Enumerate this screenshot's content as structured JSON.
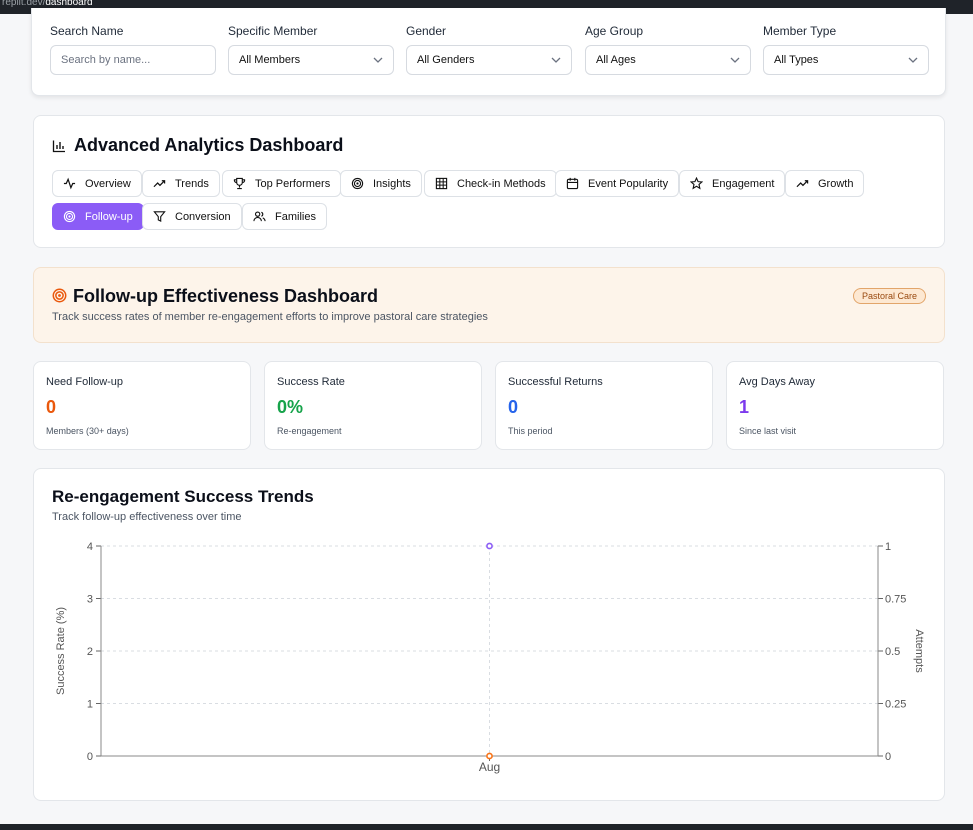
{
  "browser": {
    "url": "replit.dev/",
    "path": "dashboard"
  },
  "filters": {
    "search": {
      "label": "Search Name",
      "placeholder": "Search by name..."
    },
    "member": {
      "label": "Specific Member",
      "value": "All Members"
    },
    "gender": {
      "label": "Gender",
      "value": "All Genders"
    },
    "age": {
      "label": "Age Group",
      "value": "All Ages"
    },
    "type": {
      "label": "Member Type",
      "value": "All Types"
    }
  },
  "analytics": {
    "title": "Advanced Analytics Dashboard",
    "tabs": [
      {
        "label": "Overview",
        "icon": "activity-icon"
      },
      {
        "label": "Trends",
        "icon": "trending-up-icon"
      },
      {
        "label": "Top Performers",
        "icon": "trophy-icon"
      },
      {
        "label": "Insights",
        "icon": "target-icon"
      },
      {
        "label": "Check-in Methods",
        "icon": "grid-icon"
      },
      {
        "label": "Event Popularity",
        "icon": "calendar-icon"
      },
      {
        "label": "Engagement",
        "icon": "star-icon"
      },
      {
        "label": "Growth",
        "icon": "trending-up-icon"
      },
      {
        "label": "Follow-up",
        "icon": "target-icon",
        "active": true
      },
      {
        "label": "Conversion",
        "icon": "filter-icon"
      },
      {
        "label": "Families",
        "icon": "users-icon"
      }
    ]
  },
  "followup": {
    "title": "Follow-up Effectiveness Dashboard",
    "subtitle": "Track success rates of member re-engagement efforts to improve pastoral care strategies",
    "badge": "Pastoral Care"
  },
  "stats": [
    {
      "label": "Need Follow-up",
      "value": "0",
      "sub": "Members (30+ days)",
      "color": "#ea580c"
    },
    {
      "label": "Success Rate",
      "value": "0%",
      "sub": "Re-engagement",
      "color": "#16a34a"
    },
    {
      "label": "Successful Returns",
      "value": "0",
      "sub": "This period",
      "color": "#2563eb"
    },
    {
      "label": "Avg Days Away",
      "value": "1",
      "sub": "Since last visit",
      "color": "#7c3aed"
    }
  ],
  "chart": {
    "title": "Re-engagement Success Trends",
    "subtitle": "Track follow-up effectiveness over time"
  },
  "chart_data": {
    "type": "line",
    "categories": [
      "Aug"
    ],
    "series": [
      {
        "values": [
          0
        ],
        "axis": "left",
        "color": "#f97316"
      },
      {
        "values": [
          1
        ],
        "axis": "right",
        "color": "#8b5cf6"
      }
    ],
    "ylabel": "Success Rate (%)",
    "y2label": "Attempts",
    "ylim": [
      0,
      4
    ],
    "yticks": [
      "0",
      "1",
      "2",
      "3",
      "4"
    ],
    "y2lim": [
      0,
      1
    ],
    "y2ticks": [
      "0",
      "0.25",
      "0.5",
      "0.75",
      "1"
    ],
    "grid": true
  }
}
